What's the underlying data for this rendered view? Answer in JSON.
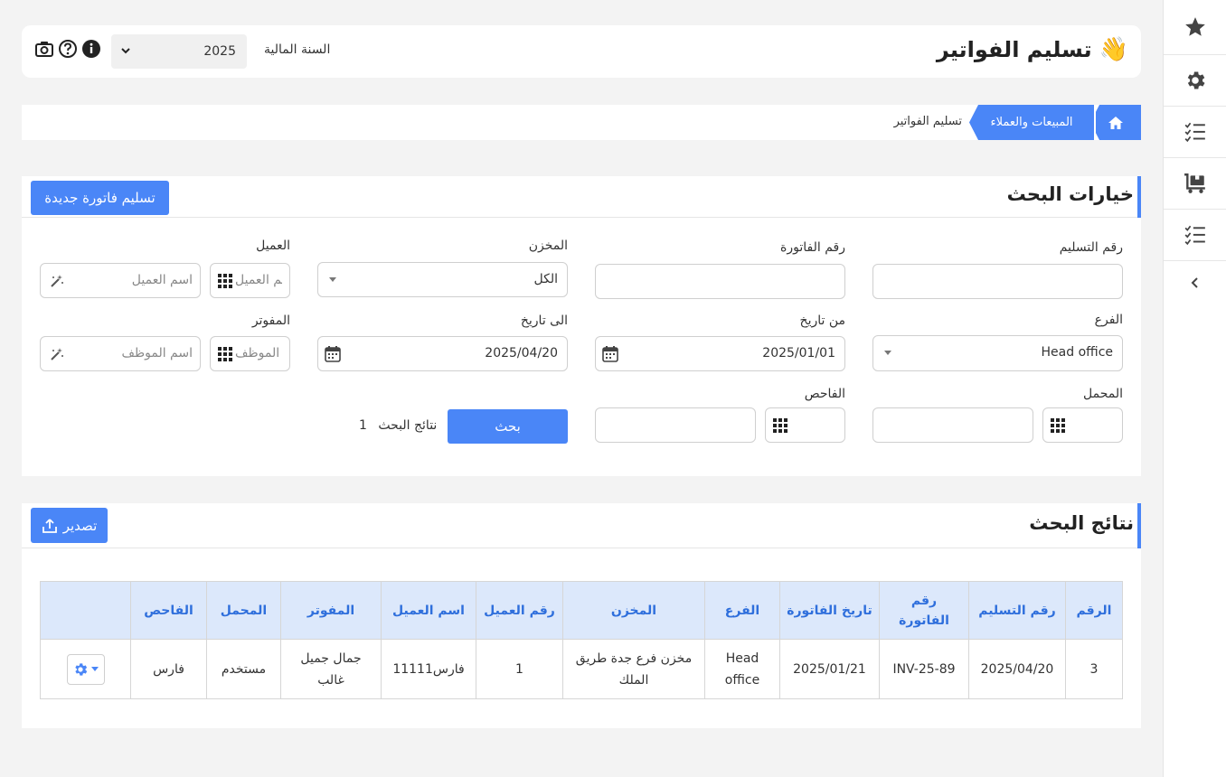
{
  "header": {
    "title": "تسليم الفواتير",
    "title_emoji": "👋",
    "fiscal_year_label": "السنة المالية",
    "fiscal_year_value": "2025"
  },
  "breadcrumb": {
    "items": [
      "المبيعات والعملاء",
      "تسليم الفواتير"
    ]
  },
  "search": {
    "title": "خيارات البحث",
    "new_button": "تسليم فاتورة جديدة",
    "fields": {
      "delivery_no_label": "رقم التسليم",
      "invoice_no_label": "رقم الفاتورة",
      "warehouse_label": "المخزن",
      "warehouse_value": "الكل",
      "customer_label": "العميل",
      "customer_no_placeholder": "رقم العميل",
      "customer_name_placeholder": "اسم العميل",
      "branch_label": "الفرع",
      "branch_value": "Head office",
      "from_date_label": "من تاريخ",
      "from_date_value": "2025/01/01",
      "to_date_label": "الى تاريخ",
      "to_date_value": "2025/04/20",
      "invoicer_label": "المفوتر",
      "employee_no_placeholder": "رقم الموظف",
      "employee_name_placeholder": "اسم الموظف",
      "loader_label": "المحمل",
      "inspector_label": "الفاحص"
    },
    "search_button": "بحث",
    "results_label": "نتائج البحث",
    "results_count": "1"
  },
  "results": {
    "title": "نتائج البحث",
    "export_button": "تصدير",
    "columns": [
      "الرقم",
      "رقم التسليم",
      "رقم الفاتورة",
      "تاريخ الفاتورة",
      "الفرع",
      "المخزن",
      "رقم العميل",
      "اسم العميل",
      "المفوتر",
      "المحمل",
      "الفاحص"
    ],
    "rows": [
      [
        "3",
        "2025/04/20",
        "INV-25-89",
        "2025/01/21",
        "Head office",
        "مخزن فرع جدة طريق الملك",
        "1",
        "فارس11111",
        "جمال جميل غالب",
        "مستخدم",
        "فارس"
      ]
    ]
  },
  "colors": {
    "accent": "#4a86f7",
    "table_header_bg": "#dce8fb",
    "table_header_text": "#2f6fdc"
  },
  "sidebar_icons": [
    "star-icon",
    "gear-icon",
    "checklist-icon",
    "cart-icon",
    "checklist-icon",
    "chevron-left-icon"
  ]
}
